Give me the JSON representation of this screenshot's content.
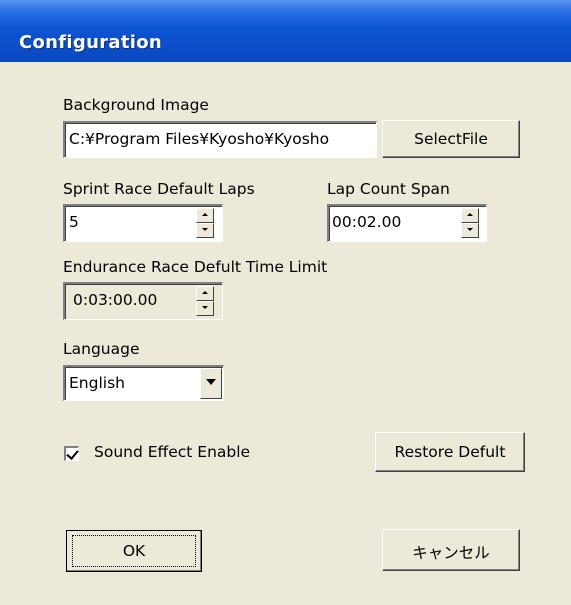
{
  "window": {
    "title": "Configuration"
  },
  "background_image": {
    "label": "Background Image",
    "value": "C:¥Program Files¥Kyosho¥Kyosho",
    "select_button": "SelectFile"
  },
  "sprint_laps": {
    "label": "Sprint Race Default Laps",
    "value": "5"
  },
  "lap_count_span": {
    "label": "Lap Count Span",
    "value": "00:02.00"
  },
  "endurance_time": {
    "label": "Endurance Race Defult Time Limit",
    "value": "0:03:00.00"
  },
  "language": {
    "label": "Language",
    "selected": "English"
  },
  "sound_effect": {
    "label": "Sound Effect Enable",
    "checked": true
  },
  "buttons": {
    "restore": "Restore Defult",
    "ok": "OK",
    "cancel": "キャンセル"
  },
  "icons": {
    "spinner_up": "arrow-up-icon",
    "spinner_down": "arrow-down-icon",
    "dropdown": "chevron-down-icon",
    "checkbox": "checkmark-icon"
  },
  "colors": {
    "titlebar": "#0b4fcc",
    "dialog_bg": "#ece9d8"
  }
}
